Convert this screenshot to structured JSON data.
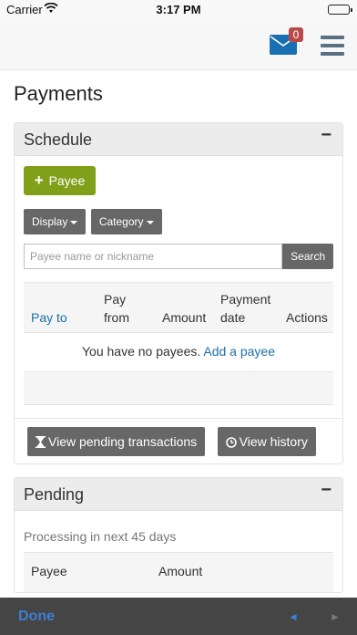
{
  "status": {
    "carrier": "Carrier",
    "time": "3:17 PM"
  },
  "navbar": {
    "mail_badge": "0"
  },
  "page": {
    "title": "Payments"
  },
  "schedule": {
    "title": "Schedule",
    "collapse_symbol": "−",
    "add_payee_label": "Payee",
    "display_label": "Display",
    "category_label": "Category",
    "search_placeholder": "Payee name or nickname",
    "search_button": "Search",
    "columns": {
      "pay_to": "Pay to",
      "pay_from_1": "Pay",
      "pay_from_2": "from",
      "amount": "Amount",
      "payment_date_1": "Payment",
      "payment_date_2": "date",
      "actions": "Actions"
    },
    "empty_text": "You have no payees.",
    "empty_link": "Add a payee",
    "view_pending_label": "View pending transactions",
    "view_history_label": "View history"
  },
  "pending": {
    "title": "Pending",
    "collapse_symbol": "−",
    "subtitle": "Processing in next 45 days",
    "columns": {
      "payee": "Payee",
      "amount": "Amount"
    }
  },
  "keyboard_toolbar": {
    "done": "Done",
    "prev": "◄",
    "next": "►"
  },
  "colors": {
    "accent": "#1b6fab",
    "add_button": "#80a01a",
    "badge": "#b94a48",
    "toolbar": "#454545"
  }
}
